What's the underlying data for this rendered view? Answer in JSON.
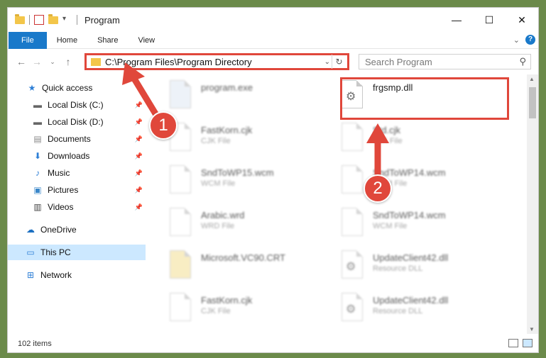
{
  "window": {
    "title": "Program",
    "minimize": "—",
    "maximize": "☐",
    "close": "✕"
  },
  "ribbon": {
    "tabs": [
      "File",
      "Home",
      "Share",
      "View"
    ]
  },
  "nav": {
    "address": "C:\\Program Files\\Program Directory",
    "search_placeholder": "Search Program"
  },
  "sidebar": {
    "items": [
      {
        "label": "Quick access",
        "icon": "star-icon"
      },
      {
        "label": "Local Disk (C:)",
        "icon": "drive-icon"
      },
      {
        "label": "Local Disk (D:)",
        "icon": "drive-icon"
      },
      {
        "label": "Documents",
        "icon": "documents-icon"
      },
      {
        "label": "Downloads",
        "icon": "download-icon"
      },
      {
        "label": "Music",
        "icon": "music-icon"
      },
      {
        "label": "Pictures",
        "icon": "pictures-icon"
      },
      {
        "label": "Videos",
        "icon": "videos-icon"
      },
      {
        "label": "OneDrive",
        "icon": "cloud-icon"
      },
      {
        "label": "This PC",
        "icon": "computer-icon"
      },
      {
        "label": "Network",
        "icon": "network-icon"
      }
    ]
  },
  "files": [
    {
      "name": "program.exe",
      "type": ""
    },
    {
      "name": "frgsmp.dll",
      "type": ""
    },
    {
      "name": "FastKorn.cjk",
      "type": "CJK File"
    },
    {
      "name": "Std.cjk",
      "type": "CJK File"
    },
    {
      "name": "SndToWP15.wcm",
      "type": "WCM File"
    },
    {
      "name": "SndToWP14.wcm",
      "type": "WCM File"
    },
    {
      "name": "Arabic.wrd",
      "type": "WRD File"
    },
    {
      "name": "SndToWP14.wcm",
      "type": "WCM File"
    },
    {
      "name": "Microsoft.VC90.CRT",
      "type": ""
    },
    {
      "name": "UpdateClient42.dll",
      "type": "Resource DLL"
    },
    {
      "name": "FastKorn.cjk",
      "type": "CJK File"
    },
    {
      "name": "UpdateClient42.dll",
      "type": "Resource DLL"
    }
  ],
  "status": {
    "item_count": "102 items"
  },
  "callouts": {
    "step1": "1",
    "step2": "2"
  },
  "colors": {
    "accent": "#1979ca",
    "highlight": "#e0473b",
    "selected": "#cce8ff"
  }
}
